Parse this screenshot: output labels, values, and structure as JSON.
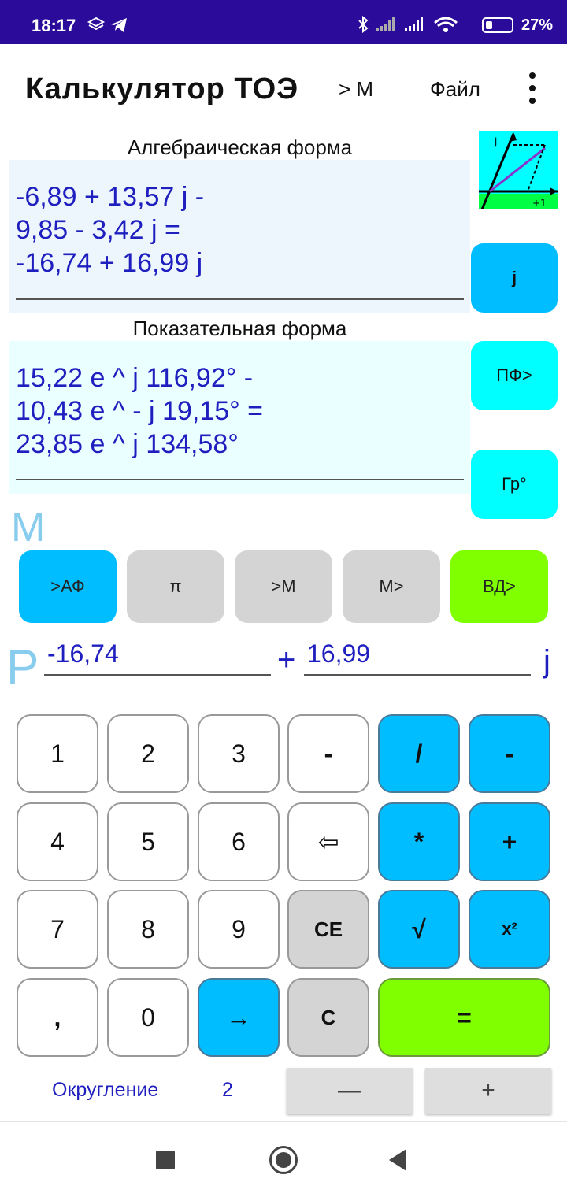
{
  "status_bar": {
    "time": "18:17",
    "battery": "27%"
  },
  "app_bar": {
    "title": "Калькулятор ТОЭ",
    "to_memory": "> M",
    "file_menu": "Файл"
  },
  "algebraic": {
    "label": "Алгебраическая форма",
    "lines": [
      "-6,89 + 13,57 j  -",
      "9,85 - 3,42 j  =",
      "-16,74 + 16,99 j"
    ]
  },
  "exponential": {
    "label": "Показательная форма",
    "lines": [
      "15,22 e ^ j 116,92° -",
      "10,43 e ^ - j 19,15° =",
      "23,85 e ^ j 134,58°"
    ]
  },
  "graph_icon": {
    "j_label": "j",
    "plus1_label": "+1"
  },
  "side_buttons": {
    "j": "j",
    "pf": "ПФ>",
    "deg": "Гр°"
  },
  "memory_label": "M",
  "memory_buttons": [
    ">АФ",
    "π",
    ">М",
    "М>",
    "ВД>"
  ],
  "result": {
    "label": "P",
    "real": "-16,74",
    "plus": "+",
    "imag": "16,99",
    "j": "j"
  },
  "keypad": {
    "row1": [
      "1",
      "2",
      "3",
      "-",
      "/",
      "-"
    ],
    "row2": [
      "4",
      "5",
      "6",
      "⇦",
      "*",
      "+"
    ],
    "row3": [
      "7",
      "8",
      "9",
      "CE",
      "√",
      "x²"
    ],
    "row4": [
      ",",
      "0",
      "→",
      "C",
      "="
    ]
  },
  "rounding": {
    "label": "Округление",
    "value": "2",
    "minus": "—",
    "plus": "+"
  },
  "colors": {
    "status_bar": "#2b0b99",
    "accent_blue": "#00bdff",
    "cyan": "#00ffff",
    "green": "#7fff00",
    "text_blue": "#1f1fc0"
  }
}
